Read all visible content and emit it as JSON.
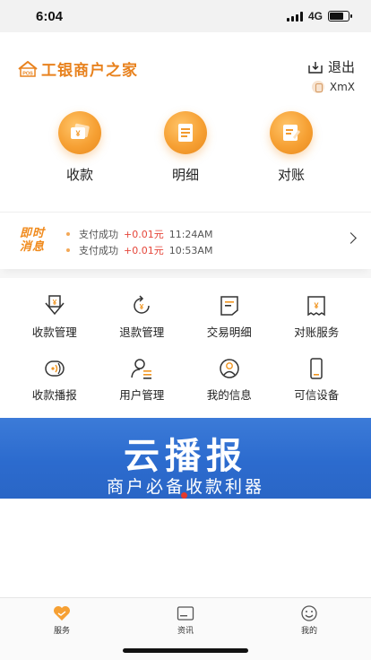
{
  "status_bar": {
    "time": "6:04",
    "network": "4G",
    "battery_level": 0.75
  },
  "header": {
    "app_name": "工银商户之家",
    "logo_badge": "POS",
    "logout_label": "退出",
    "username": "XmX"
  },
  "main_actions": [
    {
      "label": "收款",
      "icon": "collect-icon"
    },
    {
      "label": "明细",
      "icon": "detail-icon"
    },
    {
      "label": "对账",
      "icon": "reconcile-icon"
    }
  ],
  "ticker": {
    "badge_line1": "即时",
    "badge_line2": "消息",
    "messages": [
      {
        "status": "支付成功",
        "amount": "+0.01元",
        "time": "11:24AM"
      },
      {
        "status": "支付成功",
        "amount": "+0.01元",
        "time": "10:53AM"
      }
    ]
  },
  "grid": [
    {
      "label": "收款管理",
      "icon": "collect-manage-icon"
    },
    {
      "label": "退款管理",
      "icon": "refund-icon"
    },
    {
      "label": "交易明细",
      "icon": "transaction-detail-icon"
    },
    {
      "label": "对账服务",
      "icon": "reconcile-service-icon"
    },
    {
      "label": "收款播报",
      "icon": "broadcast-icon"
    },
    {
      "label": "用户管理",
      "icon": "user-manage-icon"
    },
    {
      "label": "我的信息",
      "icon": "my-info-icon"
    },
    {
      "label": "可信设备",
      "icon": "trusted-device-icon"
    }
  ],
  "banner": {
    "title": "云播报",
    "subtitle": "商户必备收款利器"
  },
  "tabbar": [
    {
      "label": "服务",
      "icon": "service-heart-icon",
      "active": true
    },
    {
      "label": "资讯",
      "icon": "news-icon",
      "active": false
    },
    {
      "label": "我的",
      "icon": "smiley-icon",
      "active": false
    }
  ],
  "colors": {
    "accent": "#f6a033",
    "amount": "#e5463a",
    "banner": "#2c6bce"
  }
}
